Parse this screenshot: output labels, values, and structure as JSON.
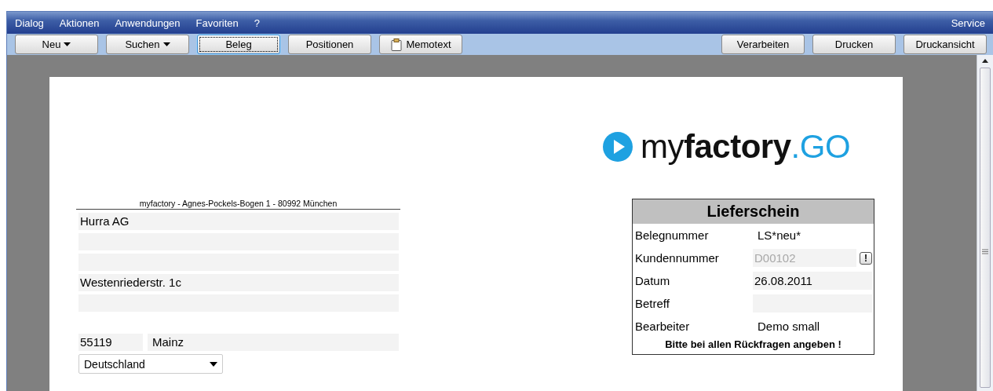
{
  "menu": [
    {
      "label": "Dialog"
    },
    {
      "label": "Aktionen"
    },
    {
      "label": "Anwendungen"
    },
    {
      "label": "Favoriten"
    },
    {
      "label": "?"
    }
  ],
  "menu_right": {
    "label": "Service"
  },
  "toolbar_left": [
    {
      "label": "Neu",
      "kind": "dropdown",
      "focused": false
    },
    {
      "label": "Suchen",
      "kind": "dropdown",
      "focused": false
    },
    {
      "label": "Beleg",
      "kind": "plain",
      "focused": true
    },
    {
      "label": "Positionen",
      "kind": "plain",
      "focused": false
    },
    {
      "label": "Memotext",
      "kind": "memo",
      "focused": false
    }
  ],
  "toolbar_right": [
    {
      "label": "Verarbeiten"
    },
    {
      "label": "Drucken"
    },
    {
      "label": "Druckansicht"
    }
  ],
  "logo": {
    "prefix": "my",
    "bold": "factory",
    "suffix": ".GO"
  },
  "sender_line": "myfactory - Agnes-Pockels-Bogen 1 - 80992 München",
  "address_lines": [
    {
      "kind": "field",
      "value": "Hurra AG"
    },
    {
      "kind": "field"
    },
    {
      "kind": "field"
    },
    {
      "kind": "field",
      "value": "Westenriederstr. 1c"
    },
    {
      "kind": "field"
    }
  ],
  "zip": "55119",
  "city": "Mainz",
  "country": "Deutschland",
  "document": {
    "title": "Lieferschein",
    "rows": [
      {
        "label": "Belegnummer",
        "value": "LS*neu*",
        "kind": "text"
      },
      {
        "label": "Kundennummer",
        "value": "D00102",
        "kind": "disabled_field"
      },
      {
        "label": "Datum",
        "value": "26.08.2011",
        "kind": "field"
      },
      {
        "label": "Betreff",
        "kind": "field"
      },
      {
        "label": "Bearbeiter",
        "value": "Demo small",
        "kind": "text"
      }
    ],
    "note": "Bitte bei allen Rückfragen angeben !",
    "info_button": "!"
  }
}
